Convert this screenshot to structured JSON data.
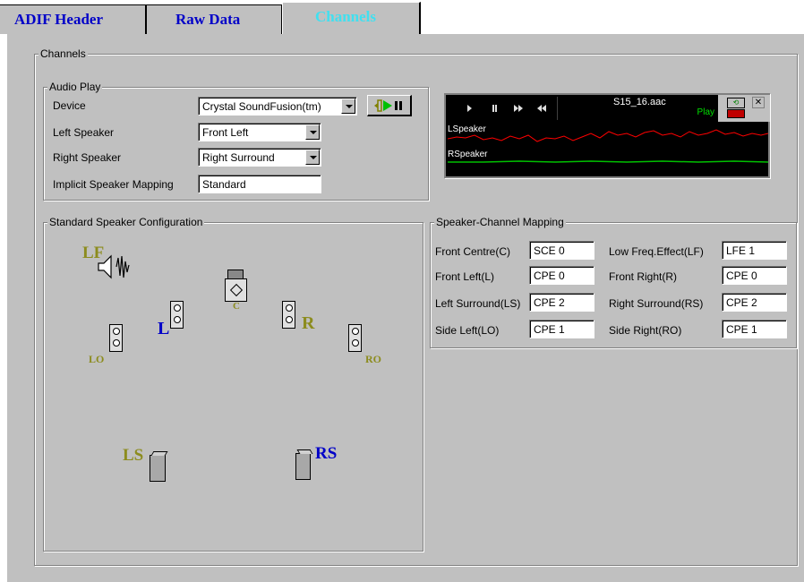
{
  "tabs": [
    {
      "label": "ADIF Header"
    },
    {
      "label": "Raw Data"
    },
    {
      "label": "Channels"
    }
  ],
  "channels_group": {
    "title": "Channels"
  },
  "audio_play": {
    "title": "Audio Play",
    "device_label": "Device",
    "device_value": "Crystal SoundFusion(tm)",
    "left_speaker_label": "Left Speaker",
    "left_speaker_value": "Front Left",
    "right_speaker_label": "Right Speaker",
    "right_speaker_value": "Right Surround",
    "implicit_label": "Implicit Speaker Mapping",
    "implicit_value": "Standard"
  },
  "player": {
    "filename": "S15_16.aac",
    "status": "Play",
    "left_label": "LSpeaker",
    "right_label": "RSpeaker",
    "left_color": "#ff0000",
    "right_color": "#00c000"
  },
  "speaker_config": {
    "title": "Standard Speaker Configuration",
    "labels": {
      "lf": "LF",
      "c": "C",
      "l": "L",
      "r": "R",
      "lo": "LO",
      "ro": "RO",
      "ls": "LS",
      "rs": "RS"
    }
  },
  "mapping": {
    "title": "Speaker-Channel Mapping",
    "rows": [
      {
        "left_label": "Front Centre(C)",
        "left_value": "SCE 0",
        "right_label": "Low Freq.Effect(LF)",
        "right_value": "LFE 1"
      },
      {
        "left_label": "Front Left(L)",
        "left_value": "CPE 0",
        "right_label": "Front Right(R)",
        "right_value": "CPE 0"
      },
      {
        "left_label": "Left Surround(LS)",
        "left_value": "CPE 2",
        "right_label": "Right Surround(RS)",
        "right_value": "CPE 2"
      },
      {
        "left_label": "Side Left(LO)",
        "left_value": "CPE 1",
        "right_label": "Side Right(RO)",
        "right_value": "CPE 1"
      }
    ]
  }
}
